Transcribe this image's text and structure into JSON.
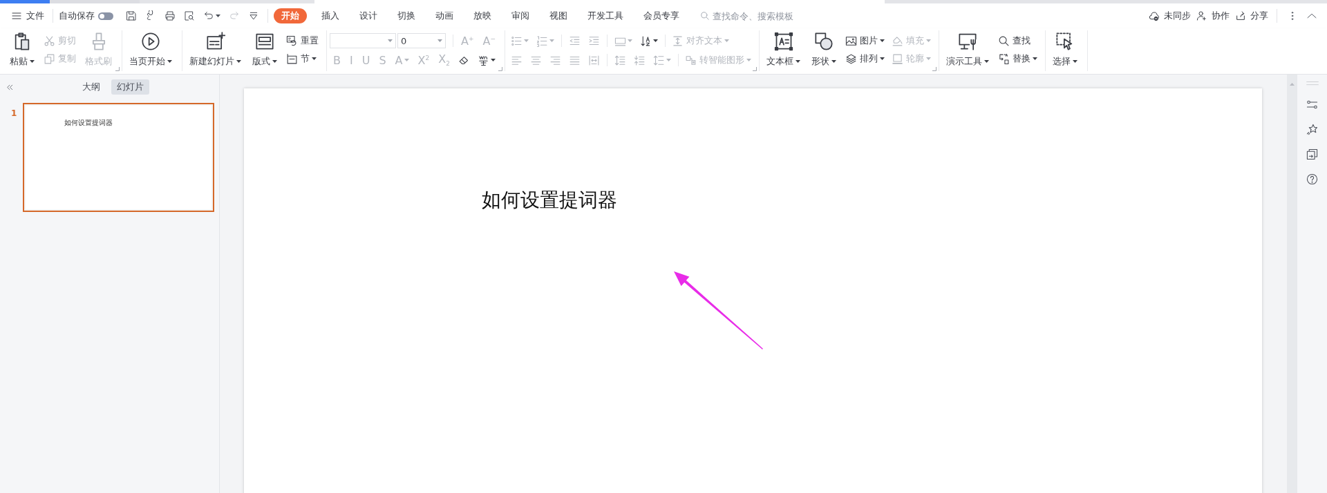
{
  "menu": {
    "file": {
      "label": "文件"
    },
    "autosave": {
      "label": "自动保存",
      "on": false
    },
    "quick_access": [
      {
        "disabled": false,
        "dropdown": false
      },
      {
        "disabled": false,
        "dropdown": false
      },
      {
        "disabled": false,
        "dropdown": false
      },
      {
        "disabled": false,
        "dropdown": false
      },
      {
        "disabled": false,
        "dropdown": true
      },
      {
        "disabled": true,
        "dropdown": false
      },
      {
        "disabled": false,
        "dropdown": false
      }
    ]
  },
  "tabs": [
    {
      "label": "开始",
      "selected": true
    },
    {
      "label": "插入",
      "selected": false
    },
    {
      "label": "设计",
      "selected": false
    },
    {
      "label": "切换",
      "selected": false
    },
    {
      "label": "动画",
      "selected": false
    },
    {
      "label": "放映",
      "selected": false
    },
    {
      "label": "审阅",
      "selected": false
    },
    {
      "label": "视图",
      "selected": false
    },
    {
      "label": "开发工具",
      "selected": false
    },
    {
      "label": "会员专享",
      "selected": false
    }
  ],
  "search": {
    "placeholder": "查找命令、搜索模板"
  },
  "account_actions": [
    {
      "label": "未同步"
    },
    {
      "label": "协作"
    },
    {
      "label": "分享"
    }
  ],
  "ribbon": {
    "groups": [
      {
        "launcher": true,
        "columns": [
          {
            "kind": "large",
            "items": [
              {
                "label": "粘贴",
                "dropdown": true,
                "disabled": false
              }
            ]
          },
          {
            "kind": "stack",
            "items": [
              {
                "label": "剪切",
                "dropdown": false,
                "disabled": true
              },
              {
                "label": "复制",
                "dropdown": false,
                "disabled": true
              }
            ]
          },
          {
            "kind": "large",
            "items": [
              {
                "label": "格式刷",
                "dropdown": false,
                "disabled": true
              }
            ]
          }
        ]
      },
      {
        "launcher": false,
        "columns": [
          {
            "kind": "large",
            "items": [
              {
                "label": "当页开始",
                "dropdown": true,
                "disabled": false
              }
            ]
          }
        ]
      },
      {
        "launcher": false,
        "columns": [
          {
            "kind": "large",
            "items": [
              {
                "label": "新建幻灯片",
                "dropdown": true,
                "disabled": false
              }
            ]
          },
          {
            "kind": "large",
            "items": [
              {
                "label": "版式",
                "dropdown": true,
                "disabled": false
              }
            ]
          },
          {
            "kind": "stack",
            "items": [
              {
                "label": "重置",
                "dropdown": false,
                "disabled": false
              },
              {
                "label": "节",
                "dropdown": true,
                "disabled": false
              }
            ]
          }
        ]
      },
      {
        "launcher": true,
        "columns": [
          {
            "kind": "rows",
            "rows": [
              [
                [
                  {
                    "kind": "field",
                    "dropdown": true
                  },
                  {
                    "kind": "field",
                    "value": "0",
                    "dropdown": true
                  }
                ],
                [
                  {
                    "kind": "glyph",
                    "glyph": "A$^{+}$",
                    "disabled": true,
                    "dropdown": false
                  },
                  {
                    "kind": "glyph",
                    "glyph": "A$^{−}$",
                    "disabled": true,
                    "dropdown": false
                  }
                ]
              ],
              [
                [
                  {
                    "kind": "glyph",
                    "glyph": "B",
                    "disabled": true,
                    "dropdown": false
                  },
                  {
                    "kind": "glyph",
                    "glyph": "I",
                    "disabled": true,
                    "dropdown": false
                  },
                  {
                    "kind": "glyph",
                    "glyph": "U",
                    "disabled": true,
                    "dropdown": false
                  },
                  {
                    "kind": "glyph",
                    "glyph": "S",
                    "disabled": true,
                    "dropdown": false
                  },
                  {
                    "kind": "glyph",
                    "glyph": "A",
                    "disabled": true,
                    "dropdown": true
                  },
                  {
                    "kind": "glyph",
                    "glyph": "X$^{2}$",
                    "disabled": true,
                    "dropdown": false
                  },
                  {
                    "kind": "glyph",
                    "glyph": "X$_{2}$",
                    "disabled": true,
                    "dropdown": false
                  },
                  {
                    "kind": "icon",
                    "disabled": false,
                    "dropdown": false
                  },
                  {
                    "kind": "icon",
                    "disabled": false,
                    "dropdown": true
                  }
                ]
              ]
            ]
          }
        ]
      },
      {
        "launcher": true,
        "columns": [
          {
            "kind": "rows",
            "rows": [
              [
                [
                  {
                    "kind": "icon",
                    "disabled": true,
                    "dropdown": true
                  },
                  {
                    "kind": "icon",
                    "disabled": true,
                    "dropdown": true
                  }
                ],
                [
                  {
                    "kind": "icon",
                    "disabled": true,
                    "dropdown": false
                  },
                  {
                    "kind": "icon",
                    "disabled": true,
                    "dropdown": false
                  }
                ],
                [
                  {
                    "kind": "icon",
                    "disabled": true,
                    "dropdown": true
                  },
                  {
                    "kind": "icon",
                    "disabled": false,
                    "dropdown": true
                  }
                ],
                [
                  {
                    "kind": "labeled",
                    "label": "对齐文本",
                    "disabled": true,
                    "dropdown": true
                  }
                ]
              ],
              [
                [
                  {
                    "kind": "icon",
                    "disabled": true,
                    "dropdown": false
                  },
                  {
                    "kind": "icon",
                    "disabled": true,
                    "dropdown": false
                  },
                  {
                    "kind": "icon",
                    "disabled": true,
                    "dropdown": false
                  },
                  {
                    "kind": "icon",
                    "disabled": true,
                    "dropdown": false
                  },
                  {
                    "kind": "icon",
                    "disabled": true,
                    "dropdown": false
                  }
                ],
                [
                  {
                    "kind": "icon",
                    "disabled": true,
                    "dropdown": false
                  },
                  {
                    "kind": "icon",
                    "disabled": true,
                    "dropdown": false
                  },
                  {
                    "kind": "icon",
                    "disabled": true,
                    "dropdown": true
                  }
                ],
                [
                  {
                    "kind": "labeled",
                    "label": "转智能图形",
                    "disabled": true,
                    "dropdown": true
                  }
                ]
              ]
            ]
          }
        ]
      },
      {
        "launcher": true,
        "columns": [
          {
            "kind": "large",
            "items": [
              {
                "label": "文本框",
                "dropdown": true,
                "disabled": false
              }
            ]
          },
          {
            "kind": "large",
            "items": [
              {
                "label": "形状",
                "dropdown": true,
                "disabled": false
              }
            ]
          },
          {
            "kind": "stack",
            "items": [
              {
                "label": "图片",
                "dropdown": true,
                "disabled": false
              },
              {
                "label": "排列",
                "dropdown": true,
                "disabled": false
              }
            ]
          },
          {
            "kind": "stack",
            "items": [
              {
                "label": "填充",
                "dropdown": true,
                "disabled": true
              },
              {
                "label": "轮廓",
                "dropdown": true,
                "disabled": true
              }
            ]
          }
        ]
      },
      {
        "launcher": false,
        "columns": [
          {
            "kind": "large",
            "items": [
              {
                "label": "演示工具",
                "dropdown": true,
                "disabled": false
              }
            ]
          },
          {
            "kind": "stack",
            "items": [
              {
                "label": "查找",
                "dropdown": false,
                "disabled": false
              },
              {
                "label": "替换",
                "dropdown": true,
                "disabled": false
              }
            ]
          }
        ]
      },
      {
        "launcher": false,
        "columns": [
          {
            "kind": "large",
            "items": [
              {
                "label": "选择",
                "dropdown": true,
                "disabled": false
              }
            ]
          }
        ]
      }
    ]
  },
  "slide_panel": {
    "tabs": [
      {
        "label": "大纲",
        "selected": false
      },
      {
        "label": "幻灯片",
        "selected": true
      }
    ],
    "thumbnails": [
      {
        "number": "1",
        "title": "如何设置提词器",
        "selected": true
      }
    ]
  },
  "slide": {
    "title": "如何设置提词器"
  }
}
